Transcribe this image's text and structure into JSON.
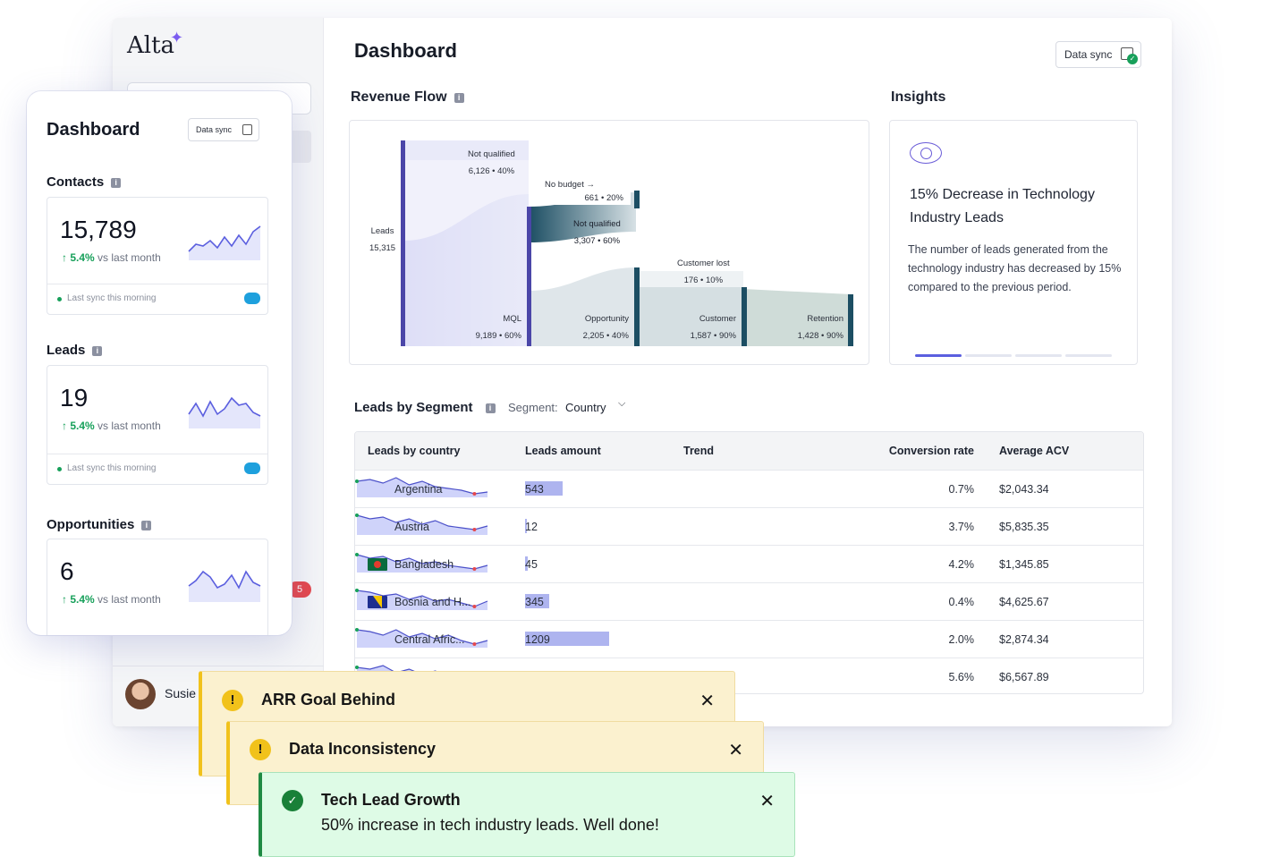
{
  "app": {
    "logo": "Alta",
    "user_name": "Susie",
    "badge_count": "5"
  },
  "main": {
    "title": "Dashboard",
    "data_sync_label": "Data sync",
    "revenue_flow": {
      "title": "Revenue Flow",
      "nodes": [
        {
          "label": "Leads",
          "value": "15,315"
        },
        {
          "label": "Not qualified",
          "value": "6,126 • 40%"
        },
        {
          "label": "MQL",
          "value": "9,189 • 60%"
        },
        {
          "label": "No budget →",
          "value": "661 • 20%"
        },
        {
          "label": "Not qualified",
          "value": "3,307 • 60%"
        },
        {
          "label": "Opportunity",
          "value": "2,205 • 40%"
        },
        {
          "label": "Customer lost",
          "value": "176  • 10%"
        },
        {
          "label": "Customer",
          "value": "1,587 • 90%"
        },
        {
          "label": "Retention",
          "value": "1,428 • 90%"
        }
      ]
    },
    "insights": {
      "title": "Insights",
      "headline": "15% Decrease in Technology Industry Leads",
      "body": "The number of leads generated from the technology industry has decreased by 15% compared to the previous period.",
      "active_slide": 1,
      "slide_count": 4
    },
    "segment": {
      "title": "Leads by Segment",
      "segment_label": "Segment:",
      "segment_value": "Country",
      "columns": [
        "Leads by country",
        "Leads amount",
        "Trend",
        "Conversion rate",
        "Average ACV"
      ],
      "rows": [
        {
          "country": "Argentina",
          "amount": "543",
          "conversion": "0.7%",
          "acv": "$2,043.34",
          "flag": "argentina"
        },
        {
          "country": "Austria",
          "amount": "12",
          "conversion": "3.7%",
          "acv": "$5,835.35",
          "flag": "austria"
        },
        {
          "country": "Bangladesh",
          "amount": "45",
          "conversion": "4.2%",
          "acv": "$1,345.85",
          "flag": "bangladesh"
        },
        {
          "country": "Bosnia and H...",
          "amount": "345",
          "conversion": "0.4%",
          "acv": "$4,625.67",
          "flag": "bosnia"
        },
        {
          "country": "Central Afric...",
          "amount": "1209",
          "conversion": "2.0%",
          "acv": "$2,874.34",
          "flag": "central-africa"
        },
        {
          "country": "",
          "amount": "",
          "conversion": "5.6%",
          "acv": "$6,567.89",
          "flag": "unknown"
        }
      ]
    }
  },
  "mobile": {
    "title": "Dashboard",
    "data_sync_label": "Data sync",
    "sections": [
      {
        "title": "Contacts",
        "value": "15,789",
        "delta": "5.4%",
        "delta_suffix": "vs last month",
        "sync": "Last sync this morning"
      },
      {
        "title": "Leads",
        "value": "19",
        "delta": "5.4%",
        "delta_suffix": "vs last month",
        "sync": "Last sync this morning"
      },
      {
        "title": "Opportunities",
        "value": "6",
        "delta": "5.4%",
        "delta_suffix": "vs last month",
        "sync": ""
      }
    ]
  },
  "toasts": [
    {
      "kind": "warning",
      "title": "ARR Goal Behind",
      "message": ""
    },
    {
      "kind": "warning",
      "title": "Data Inconsistency",
      "message": ""
    },
    {
      "kind": "success",
      "title": "Tech Lead Growth",
      "message": "50% increase in tech industry leads. Well done!"
    }
  ],
  "colors": {
    "accent": "#5b5fdf",
    "success": "#198038",
    "warning": "#f1c21b",
    "sankey_dark": "#1c4e63"
  },
  "icons": [
    "sparkle-icon",
    "search-icon",
    "data-sync-icon",
    "info-icon",
    "eye-icon",
    "chevron-down-icon",
    "warning-icon",
    "check-circle-icon",
    "close-icon",
    "salesforce-icon"
  ]
}
